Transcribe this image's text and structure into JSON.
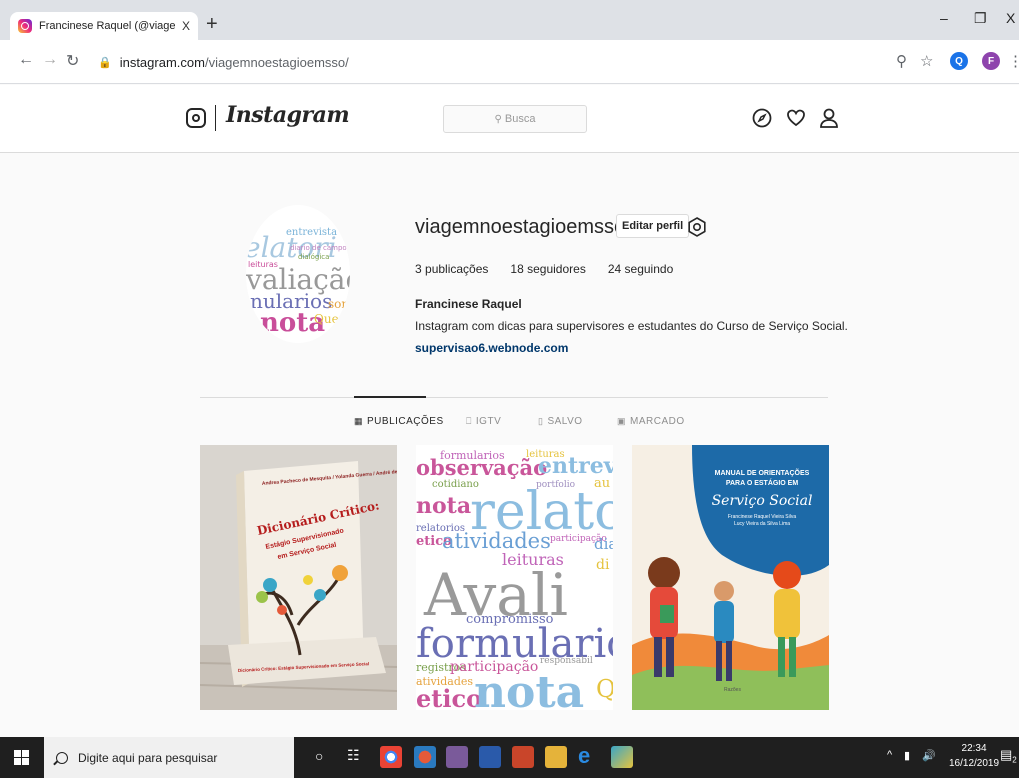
{
  "browser": {
    "tab_title": "Francinese Raquel (@viagemnoe",
    "tab_close": "X",
    "new_tab": "+",
    "url_host": "instagram.com",
    "url_path": "/viagemnoestagioemsso/",
    "ext_initials": [
      "Q",
      "F"
    ],
    "window_controls": [
      "–",
      "❐",
      "X"
    ]
  },
  "ig_header": {
    "wordmark": "Instagram",
    "search_placeholder": "Busca"
  },
  "profile": {
    "username": "viagemnoestagioemsso",
    "edit_button": "Editar perfil",
    "stats": [
      {
        "value": "3",
        "label": "publicações"
      },
      {
        "value": "18",
        "label": "seguidores"
      },
      {
        "value": "24",
        "label": "seguindo"
      }
    ],
    "full_name": "Francinese Raquel",
    "bio": "Instagram com dicas para supervisores e estudantes do Curso de Serviço Social.",
    "website": "supervisao6.webnode.com",
    "avatar_words": [
      "entrevista",
      "elatori",
      "diario de campo",
      "dialógica",
      "leituras",
      "valiação",
      "nularios",
      "som",
      "nota",
      "Questi"
    ]
  },
  "profile_tabs": [
    {
      "label": "PUBLICAÇÕES",
      "icon": "grid-icon",
      "active": true
    },
    {
      "label": "IGTV",
      "icon": "tv-icon",
      "active": false
    },
    {
      "label": "SALVO",
      "icon": "bookmark-icon",
      "active": false
    },
    {
      "label": "MARCADO",
      "icon": "tag-icon",
      "active": false
    }
  ],
  "posts": {
    "book": {
      "authors": "Andrea Pacheco de Mesquita / Yolanda Guerra / André de Menezes Gonçalves / Organização",
      "title_1": "Dicionário Crítico:",
      "title_2": "Estágio Supervisionado",
      "title_3": "em Serviço Social",
      "spine": "Dicionário Crítico: Estágio Supervisionado em Serviço Social"
    },
    "wordcloud": [
      "formularios",
      "leituras",
      "observação",
      "entrev",
      "cotidiano",
      "portfolio",
      "au",
      "nota",
      "relato",
      "relatorios",
      "etico",
      "atividades",
      "participação",
      "dia",
      "leituras",
      "di",
      "Avali",
      "compromisso",
      "formulario",
      "registros",
      "participação",
      "responsabil",
      "atividades",
      "etico",
      "nota",
      "Q"
    ],
    "manual": {
      "title_1": "MANUAL DE ORIENTAÇÕES",
      "title_2": "PARA O ESTÁGIO EM",
      "title_3": "Serviço Social",
      "authors_1": "Francinese Raquel Vieira Silva",
      "authors_2": "Lucy Vieira da Silva Lima",
      "publisher": "Razões"
    }
  },
  "taskbar": {
    "search_placeholder": "Digite aqui para pesquisar",
    "time": "22:34",
    "date": "16/12/2019",
    "notification_count": "2"
  },
  "colors": {
    "ig_link": "#00376b",
    "manual_bg": "#1d6aa8",
    "taskbar": "#1f1f1f"
  }
}
